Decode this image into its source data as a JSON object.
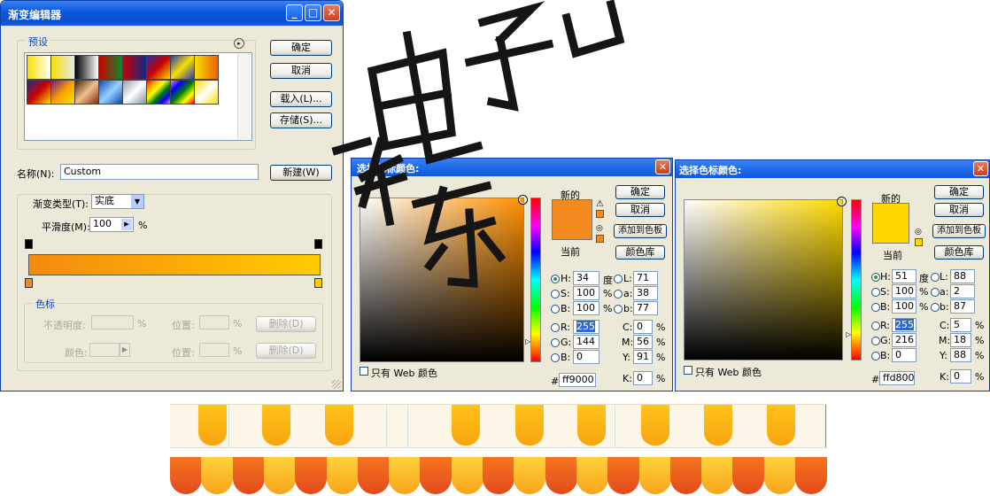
{
  "gradient_editor": {
    "title": "渐变编辑器",
    "presets_label": "预设",
    "ok": "确定",
    "cancel": "取消",
    "load": "载入(L)...",
    "save": "存储(S)...",
    "name_label": "名称(N):",
    "name_value": "Custom",
    "new_button": "新建(W)",
    "type_label": "渐变类型(T):",
    "type_value": "实底",
    "smooth_label": "平滑度(M):",
    "smooth_value": "100",
    "smooth_unit": "%",
    "color_stop_group": "色标",
    "opacity_label": "不透明度:",
    "opacity_unit": "%",
    "position_label_1": "位置:",
    "position_unit_1": "%",
    "delete_1": "删除(D)",
    "color_label": "颜色:",
    "position_label_2": "位置:",
    "position_unit_2": "%",
    "delete_2": "删除(D)",
    "gradient_colors": [
      "#f58a0e",
      "#ffcc00"
    ]
  },
  "picker_left": {
    "title": "选择色标颜色:",
    "new_label": "新的",
    "current_label": "当前",
    "ok": "确定",
    "cancel": "取消",
    "add_swatch": "添加到色板",
    "color_lib": "颜色库",
    "web_only": "只有 Web 颜色",
    "H": "34",
    "H_unit": "度",
    "S": "100",
    "S_unit": "%",
    "B": "100",
    "B_unit": "%",
    "R": "255",
    "G": "144",
    "Bv": "0",
    "L": "71",
    "a": "38",
    "b": "77",
    "C": "0",
    "M": "56",
    "Y": "91",
    "K": "0",
    "hex": "ff9000",
    "new_color": "#ff9000",
    "current_color": "#ff9000"
  },
  "picker_right": {
    "title": "选择色标颜色:",
    "new_label": "新的",
    "current_label": "当前",
    "ok": "确定",
    "cancel": "取消",
    "add_swatch": "添加到色板",
    "color_lib": "颜色库",
    "web_only": "只有 Web 颜色",
    "H": "51",
    "H_unit": "度",
    "S": "100",
    "S_unit": "%",
    "B": "100",
    "B_unit": "%",
    "R": "255",
    "G": "216",
    "Bv": "0",
    "L": "88",
    "a": "2",
    "b": "87",
    "C": "5",
    "M": "18",
    "Y": "88",
    "K": "0",
    "hex": "ffd800",
    "new_color": "#ffd800",
    "current_color": "#ffd800"
  },
  "labels_common": {
    "H": "H:",
    "S": "S:",
    "B": "B:",
    "R": "R:",
    "G": "G:",
    "Bv": "B:",
    "L": "L:",
    "a": "a:",
    "b": "b:",
    "C": "C:",
    "M": "M:",
    "Y": "Y:",
    "K": "K:",
    "pct": "%",
    "hash": "#"
  },
  "watermark_text": "东软电子出版社"
}
